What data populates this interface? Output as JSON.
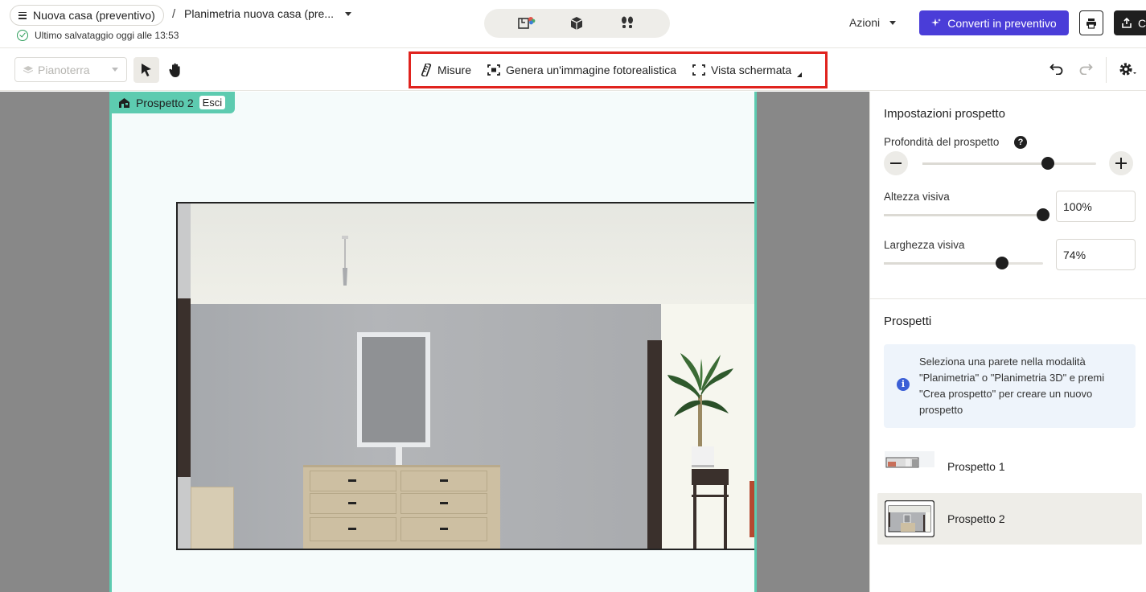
{
  "header": {
    "project_name": "Nuova casa (preventivo)",
    "separator": "/",
    "plan_name": "Planimetria nuova casa (pre...",
    "save_status": "Ultimo salvataggio oggi alle 13:53",
    "actions_label": "Azioni",
    "convert_label": "Converti in preventivo",
    "share_label": "C",
    "view_modes": [
      "2d-floorplan-icon",
      "3d-box-icon",
      "walkthrough-footsteps-icon"
    ]
  },
  "toolbar": {
    "floor_label": "Pianoterra",
    "measures_label": "Misure",
    "photoreal_label": "Genera un'immagine fotorealistica",
    "fullscreen_label": "Vista schermata"
  },
  "canvas": {
    "frame_label": "Prospetto 2",
    "exit_label": "Esci"
  },
  "panel": {
    "settings_title": "Impostazioni prospetto",
    "depth_label": "Profondità del prospetto",
    "depth_level": 0.72,
    "height_label": "Altezza visiva",
    "height_value": "100%",
    "height_level": 1.0,
    "width_label": "Larghezza visiva",
    "width_value": "74%",
    "width_level": 0.74,
    "elevations_title": "Prospetti",
    "info_text": "Seleziona una parete nella modalità \"Planimetria\" o \"Planimetria 3D\" e premi \"Crea prospetto\" per creare un nuovo prospetto",
    "elevations": [
      {
        "label": "Prospetto 1",
        "active": false
      },
      {
        "label": "Prospetto 2",
        "active": true
      }
    ]
  },
  "colors": {
    "accent": "#4a3dd8",
    "frame": "#5dcbb0",
    "highlight_box": "#e0231e",
    "info_bg": "#eef4fb"
  }
}
